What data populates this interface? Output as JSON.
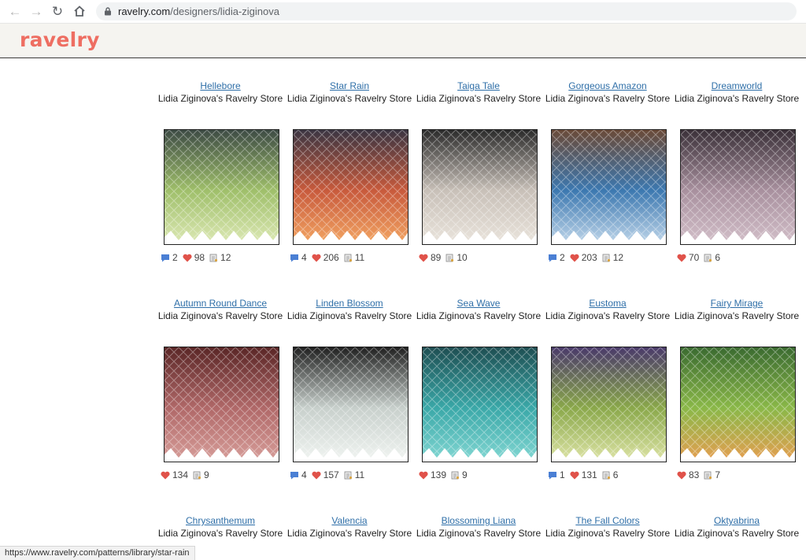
{
  "browser": {
    "url_host": "ravelry.com",
    "url_path": "/designers/lidia-ziginova",
    "icons": [
      "back-arrow-icon",
      "forward-arrow-icon",
      "reload-icon",
      "home-icon",
      "lock-icon"
    ]
  },
  "site": {
    "logo": "ravelry",
    "brand_color": "#ee6e62"
  },
  "patterns": [
    {
      "title": "Hellebore",
      "store": "Lidia Ziginova's Ravelry Store",
      "comments": "2",
      "hearts": "98",
      "projects": "12",
      "colors": [
        "#3d4b44",
        "#9fbf6a",
        "#d9e6b0"
      ]
    },
    {
      "title": "Star Rain",
      "store": "Lidia Ziginova's Ravelry Store",
      "comments": "4",
      "hearts": "206",
      "projects": "11",
      "colors": [
        "#3b3542",
        "#c85a3c",
        "#f0a060"
      ]
    },
    {
      "title": "Taiga Tale",
      "store": "Lidia Ziginova's Ravelry Store",
      "comments": "",
      "hearts": "89",
      "projects": "10",
      "colors": [
        "#2a2a2a",
        "#c8c0b8",
        "#e8e2da"
      ]
    },
    {
      "title": "Gorgeous Amazon",
      "store": "Lidia Ziginova's Ravelry Store",
      "comments": "2",
      "hearts": "203",
      "projects": "12",
      "colors": [
        "#6a4a38",
        "#3c78b0",
        "#b7d0e6"
      ]
    },
    {
      "title": "Dreamworld",
      "store": "Lidia Ziginova's Ravelry Store",
      "comments": "",
      "hearts": "70",
      "projects": "6",
      "colors": [
        "#3a3038",
        "#a8909e",
        "#d0bcc6"
      ]
    },
    {
      "title": "Autumn Round Dance",
      "store": "Lidia Ziginova's Ravelry Store",
      "comments": "",
      "hearts": "134",
      "projects": "9",
      "colors": [
        "#5a2626",
        "#b06868",
        "#d49a96"
      ]
    },
    {
      "title": "Linden Blossom",
      "store": "Lidia Ziginova's Ravelry Store",
      "comments": "4",
      "hearts": "157",
      "projects": "11",
      "colors": [
        "#202020",
        "#c8d0cc",
        "#eef2ef"
      ]
    },
    {
      "title": "Sea Wave",
      "store": "Lidia Ziginova's Ravelry Store",
      "comments": "",
      "hearts": "139",
      "projects": "9",
      "colors": [
        "#1e4e52",
        "#3aa8a8",
        "#7ed4d0"
      ]
    },
    {
      "title": "Eustoma",
      "store": "Lidia Ziginova's Ravelry Store",
      "comments": "1",
      "hearts": "131",
      "projects": "6",
      "colors": [
        "#4a3a6a",
        "#8aa84a",
        "#d8e0a0"
      ]
    },
    {
      "title": "Fairy Mirage",
      "store": "Lidia Ziginova's Ravelry Store",
      "comments": "",
      "hearts": "83",
      "projects": "7",
      "colors": [
        "#3a6a30",
        "#8ab848",
        "#e0a050"
      ]
    },
    {
      "title": "Chrysanthemum",
      "store": "Lidia Ziginova's Ravelry Store"
    },
    {
      "title": "Valencia",
      "store": "Lidia Ziginova's Ravelry Store"
    },
    {
      "title": "Blossoming Liana",
      "store": "Lidia Ziginova's Ravelry Store"
    },
    {
      "title": "The Fall Colors",
      "store": "Lidia Ziginova's Ravelry Store"
    },
    {
      "title": "Oktyabrina",
      "store": "Lidia Ziginova's Ravelry Store"
    }
  ],
  "colors": {
    "link": "#2f6fa8",
    "heart": "#e0524a",
    "comment": "#4a7fd4"
  },
  "status_bar": {
    "text": "https://www.ravelry.com/patterns/library/star-rain"
  }
}
